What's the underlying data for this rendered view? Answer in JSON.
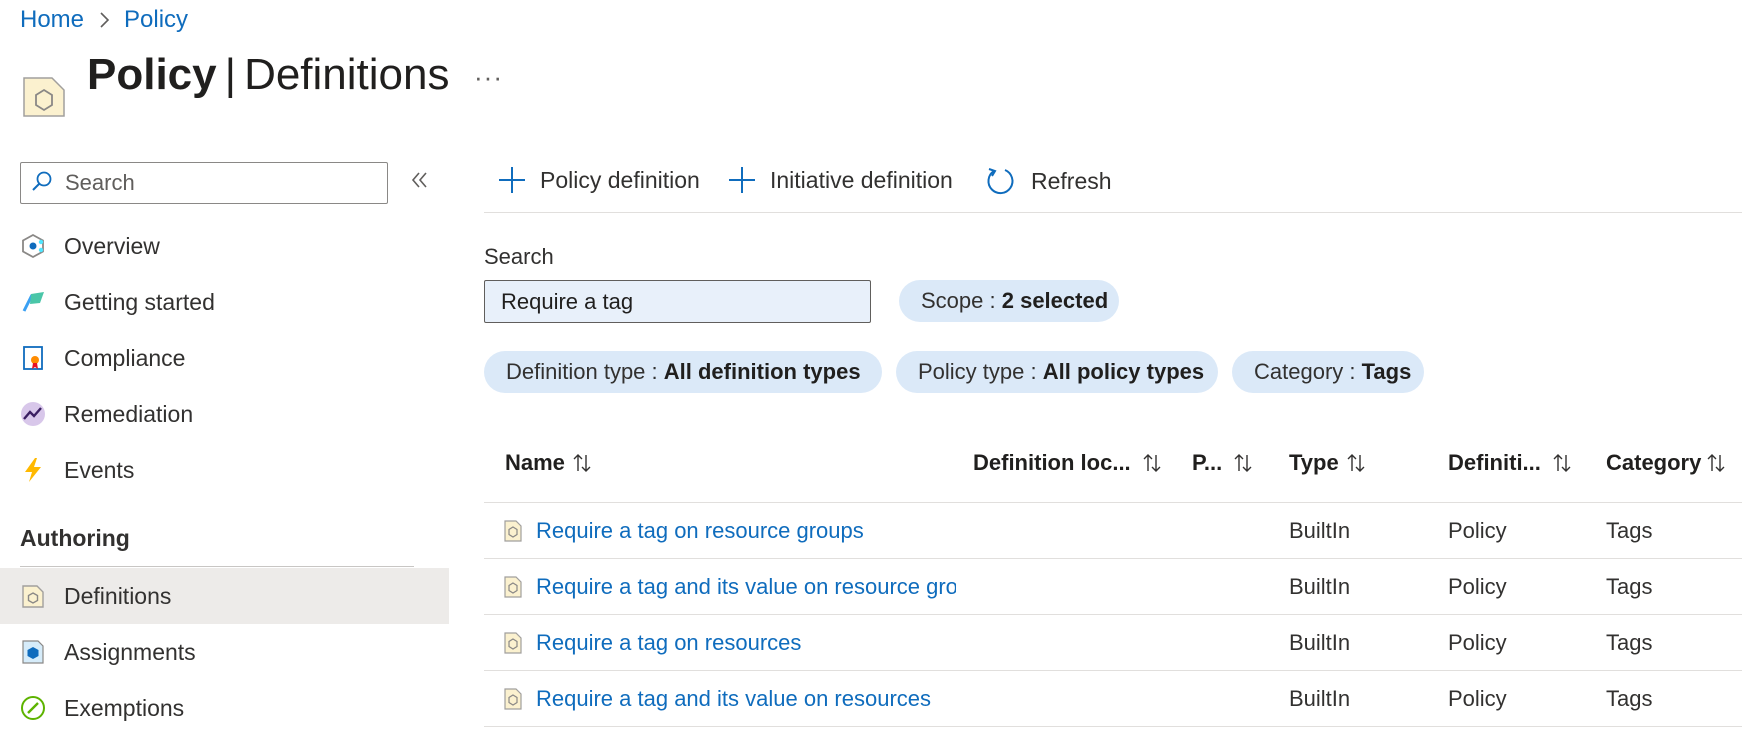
{
  "breadcrumb": {
    "home": "Home",
    "current": "Policy"
  },
  "page": {
    "title_bold": "Policy",
    "title_separator": "|",
    "title_rest": "Definitions",
    "more": "···"
  },
  "nav": {
    "search_placeholder": "Search",
    "items": [
      {
        "label": "Overview",
        "icon": "overview-icon"
      },
      {
        "label": "Getting started",
        "icon": "getting-started-icon"
      },
      {
        "label": "Compliance",
        "icon": "compliance-icon"
      },
      {
        "label": "Remediation",
        "icon": "remediation-icon"
      },
      {
        "label": "Events",
        "icon": "lightning-icon"
      }
    ],
    "section_authoring": "Authoring",
    "authoring_items": [
      {
        "label": "Definitions",
        "icon": "definitions-icon",
        "selected": true
      },
      {
        "label": "Assignments",
        "icon": "assignments-icon"
      },
      {
        "label": "Exemptions",
        "icon": "exemptions-icon"
      }
    ]
  },
  "toolbar": {
    "policy_definition": "Policy definition",
    "initiative_definition": "Initiative definition",
    "refresh": "Refresh"
  },
  "filters": {
    "search_label": "Search",
    "search_value": "Require a tag",
    "scope_label": "Scope : ",
    "scope_value": "2 selected",
    "definition_type_label": "Definition type : ",
    "definition_type_value": "All definition types",
    "policy_type_label": "Policy type : ",
    "policy_type_value": "All policy types",
    "category_label": "Category : ",
    "category_value": "Tags"
  },
  "table": {
    "columns": {
      "name": "Name",
      "definition_location": "Definition loc...",
      "policies": "P...",
      "type": "Type",
      "definition_type": "Definiti...",
      "category": "Category"
    },
    "rows": [
      {
        "name": "Require a tag on resource groups",
        "type": "BuiltIn",
        "definition_type": "Policy",
        "category": "Tags"
      },
      {
        "name": "Require a tag and its value on resource groups",
        "type": "BuiltIn",
        "definition_type": "Policy",
        "category": "Tags"
      },
      {
        "name": "Require a tag on resources",
        "type": "BuiltIn",
        "definition_type": "Policy",
        "category": "Tags"
      },
      {
        "name": "Require a tag and its value on resources",
        "type": "BuiltIn",
        "definition_type": "Policy",
        "category": "Tags"
      }
    ]
  },
  "colors": {
    "accent": "#0f6cbd",
    "pill_bg": "#dbe9f8",
    "selected_bg": "#edebe9",
    "search_bg": "#e8f0fa"
  }
}
